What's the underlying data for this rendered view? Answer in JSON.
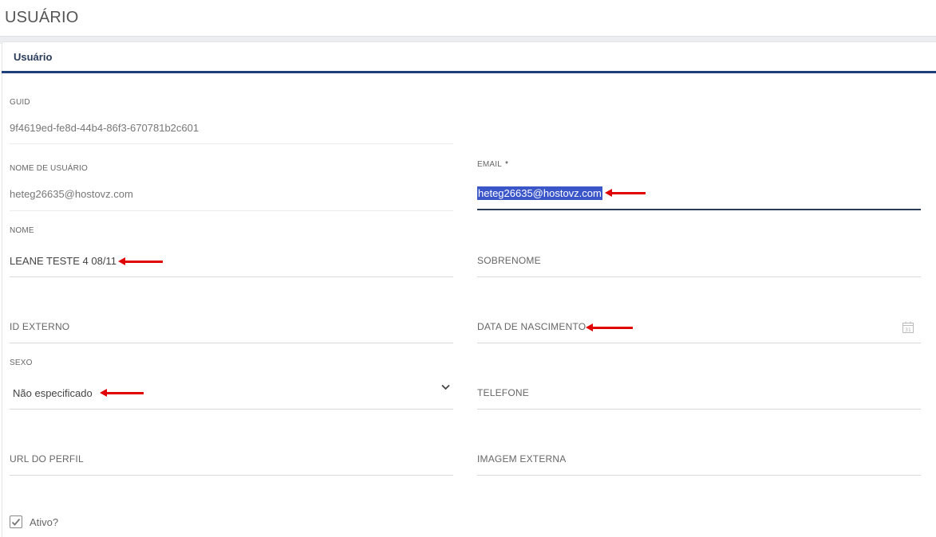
{
  "page": {
    "title": "USUÁRIO"
  },
  "tabs": {
    "active_label": "Usuário"
  },
  "form": {
    "guid": {
      "label": "GUID",
      "value": "9f4619ed-fe8d-44b4-86f3-670781b2c601"
    },
    "username": {
      "label": "NOME DE USUÁRIO",
      "value": "heteg26635@hostovz.com"
    },
    "email": {
      "label": "EMAIL",
      "required_mark": "*",
      "value": "heteg26635@hostovz.com"
    },
    "nome": {
      "label": "NOME",
      "value": "LEANE TESTE 4 08/11"
    },
    "sobrenome": {
      "placeholder": "SOBRENOME"
    },
    "id_externo": {
      "placeholder": "ID EXTERNO"
    },
    "data_nascimento": {
      "placeholder": "DATA DE NASCIMENTO"
    },
    "sexo": {
      "label": "SEXO",
      "selected": "Não especificado"
    },
    "telefone": {
      "placeholder": "TELEFONE"
    },
    "url_perfil": {
      "placeholder": "URL DO PERFIL"
    },
    "imagem_externa": {
      "placeholder": "IMAGEM EXTERNA"
    },
    "ativo": {
      "label": "Ativo?",
      "checked": true
    }
  },
  "colors": {
    "tab_underline": "#1d3f7a",
    "selection": "#3b56c9",
    "annotation_arrow": "#e00000"
  }
}
